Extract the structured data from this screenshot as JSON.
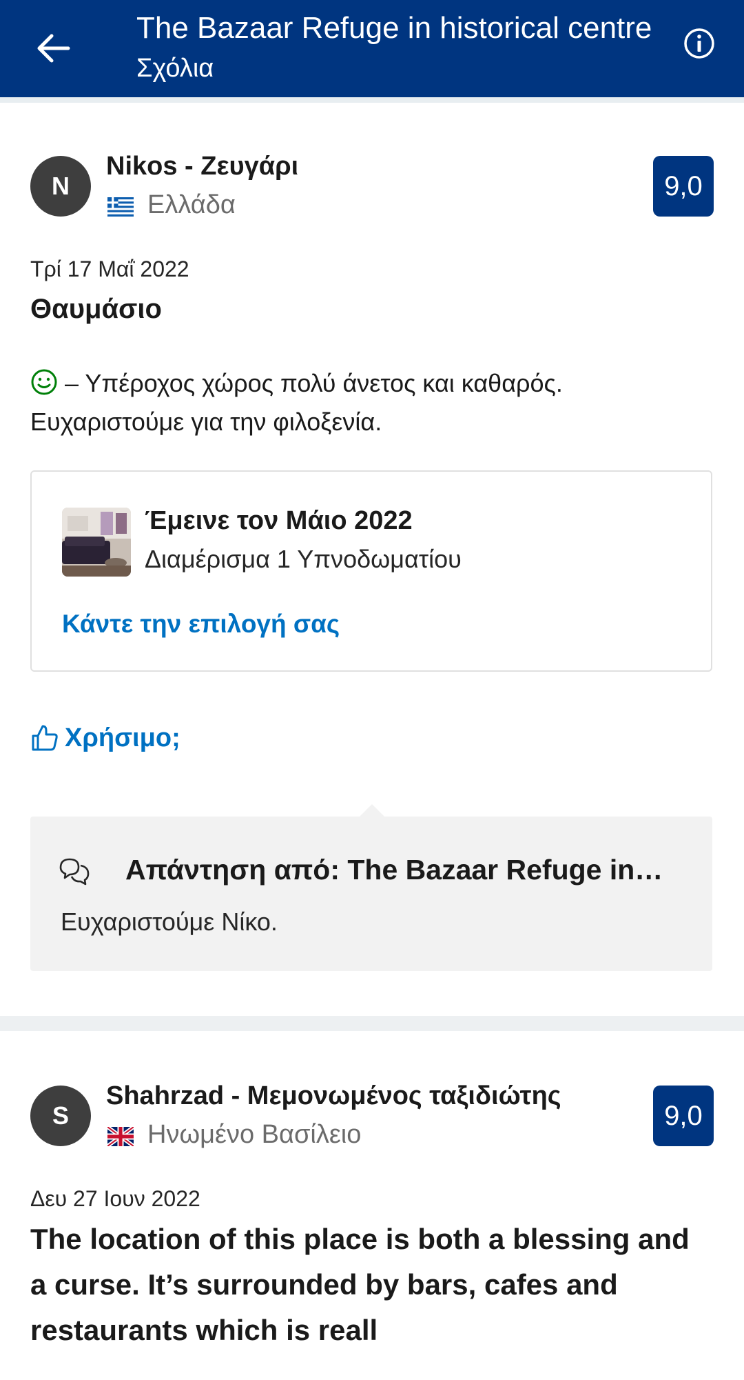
{
  "header": {
    "title": "The Bazaar Refuge in historical centre",
    "subtitle": "Σχόλια"
  },
  "reviews": [
    {
      "avatar_initial": "N",
      "name": "Nikos - Ζευγάρι",
      "country": "Ελλάδα",
      "flag": "greece-flag",
      "score": "9,0",
      "date": "Τρί 17 Μαΐ 2022",
      "title": "Θαυμάσιο",
      "positive_text": " – Υπέροχος χώρος πολύ άνετος και καθαρός. Ευχαριστούμε για την φιλοξενία.",
      "stay": {
        "title": "Έμεινε τον Μάιο 2022",
        "room": "Διαμέρισμα 1 Υπνοδωματίου",
        "link": "Κάντε την επιλογή σας"
      },
      "helpful_label": "Χρήσιμο;",
      "reply": {
        "title": "Απάντηση από: The Bazaar Refuge in…",
        "text": "Ευχαριστούμε Νίκο."
      }
    },
    {
      "avatar_initial": "S",
      "name": "Shahrzad - Μεμονωμένος ταξιδιώτης",
      "country": "Ηνωμένο Βασίλειο",
      "flag": "uk-flag",
      "score": "9,0",
      "date": "Δευ 27 Ιουν 2022",
      "title": "The location of this place is both a blessing and a curse. It’s surrounded by bars, cafes and restaurants which is reall"
    }
  ],
  "colors": {
    "brand_blue": "#003580",
    "link_blue": "#0071c2",
    "positive_green": "#008009"
  }
}
